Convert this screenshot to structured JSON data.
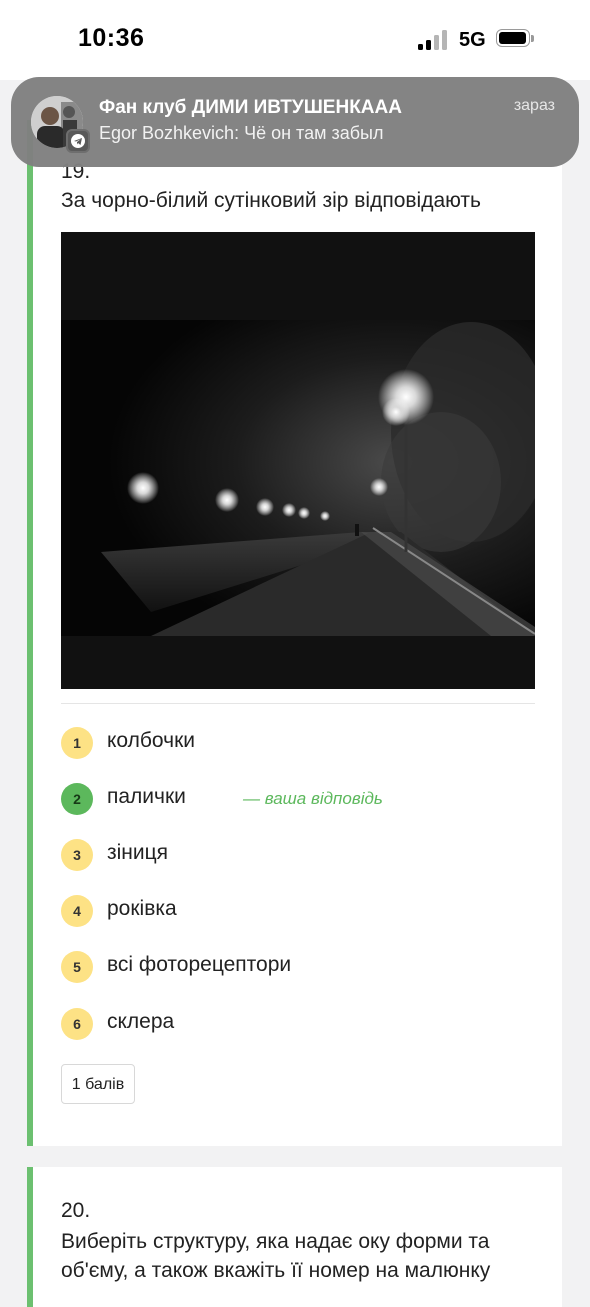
{
  "status": {
    "time": "10:36",
    "network": "5G"
  },
  "notification": {
    "title": "Фан клуб ДИМИ ИВТУШЕНКААА",
    "message": "Egor Bozhkevich: Чё он там забыл",
    "time": "зараз",
    "app_icon": "telegram-icon"
  },
  "question19": {
    "number": "19.",
    "text": "За чорно-білий сутінковий зір відповідають",
    "options": [
      {
        "num": "1",
        "label": "колбочки"
      },
      {
        "num": "2",
        "label": "палички",
        "selected": true
      },
      {
        "num": "3",
        "label": "зіниця"
      },
      {
        "num": "4",
        "label": "роківка"
      },
      {
        "num": "5",
        "label": "всі фоторецептори"
      },
      {
        "num": "6",
        "label": "склера"
      }
    ],
    "your_answer": "— ваша відповідь",
    "points": "1 балів"
  },
  "question20": {
    "number": "20.",
    "text": "Виберіть структуру, яка надає оку форми та об'єму, а також вкажіть її номер на малюнку"
  },
  "colors": {
    "accent": "#6cc070",
    "correct": "#5cb85c",
    "badge": "#fde285"
  }
}
